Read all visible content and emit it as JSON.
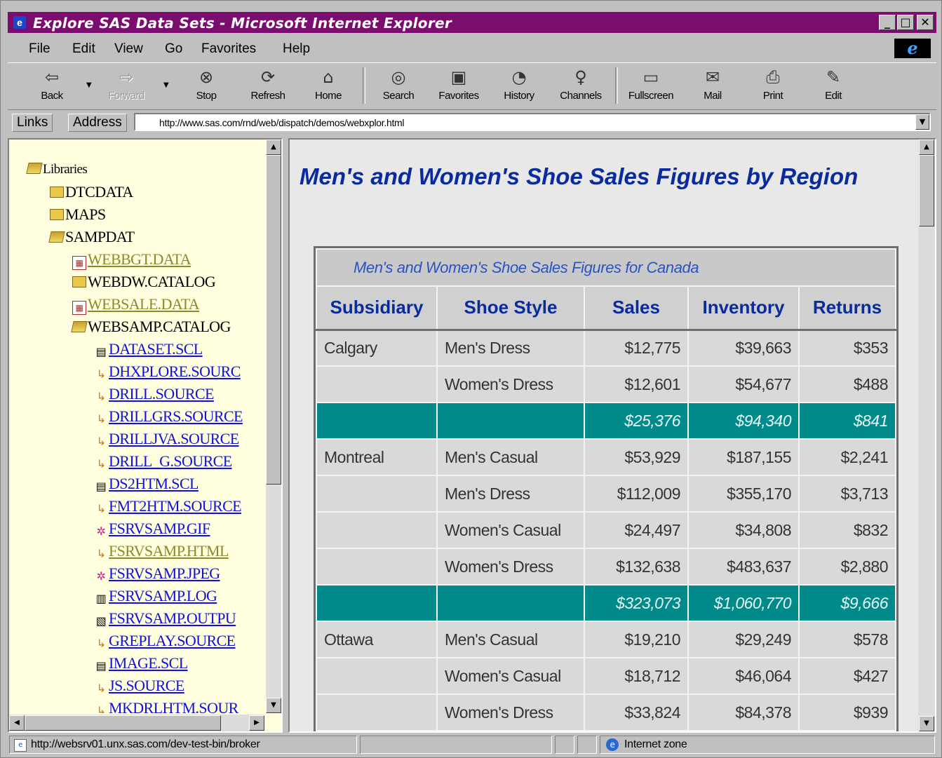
{
  "window": {
    "title": "Explore SAS Data Sets - Microsoft Internet Explorer"
  },
  "menu": [
    "File",
    "Edit",
    "View",
    "Go",
    "Favorites",
    "Help"
  ],
  "toolbar": {
    "back": "Back",
    "forward": "Forward",
    "stop": "Stop",
    "refresh": "Refresh",
    "home": "Home",
    "search": "Search",
    "favorites": "Favorites",
    "history": "History",
    "channels": "Channels",
    "fullscreen": "Fullscreen",
    "mail": "Mail",
    "print": "Print",
    "edit": "Edit"
  },
  "address": {
    "links_label": "Links",
    "address_label": "Address",
    "url": "http://www.sas.com/rnd/web/dispatch/demos/webxplor.html"
  },
  "tree": {
    "root": "Libraries",
    "libs": [
      "DTCDATA",
      "MAPS",
      "SAMPDAT"
    ],
    "sampdat_items": [
      "WEBBGT.DATA",
      "WEBDW.CATALOG",
      "WEBSALE.DATA",
      "WEBSAMP.CATALOG"
    ],
    "websamp_items": [
      "DATASET.SCL",
      "DHXPLORE.SOURC",
      "DRILL.SOURCE",
      "DRILLGRS.SOURCE",
      "DRILLJVA.SOURCE",
      "DRILL_G.SOURCE",
      "DS2HTM.SCL",
      "FMT2HTM.SOURCE",
      "FSRVSAMP.GIF",
      "FSRVSAMP.HTML",
      "FSRVSAMP.JPEG",
      "FSRVSAMP.LOG",
      "FSRVSAMP.OUTPU",
      "GREPLAY.SOURCE",
      "IMAGE.SCL",
      "JS.SOURCE",
      "MKDRLHTM.SOUR"
    ]
  },
  "page": {
    "title": "Men's and Women's Shoe Sales Figures by Region",
    "table_caption": "Men's and Women's Shoe Sales Figures for Canada",
    "columns": [
      "Subsidiary",
      "Shoe Style",
      "Sales",
      "Inventory",
      "Returns"
    ],
    "rows": [
      {
        "type": "data",
        "cells": [
          "Calgary",
          "Men's Dress",
          "$12,775",
          "$39,663",
          "$353"
        ]
      },
      {
        "type": "data",
        "cells": [
          "",
          "Women's Dress",
          "$12,601",
          "$54,677",
          "$488"
        ]
      },
      {
        "type": "total",
        "cells": [
          "",
          "",
          "$25,376",
          "$94,340",
          "$841"
        ]
      },
      {
        "type": "data",
        "cells": [
          "Montreal",
          "Men's Casual",
          "$53,929",
          "$187,155",
          "$2,241"
        ]
      },
      {
        "type": "data",
        "cells": [
          "",
          "Men's Dress",
          "$112,009",
          "$355,170",
          "$3,713"
        ]
      },
      {
        "type": "data",
        "cells": [
          "",
          "Women's Casual",
          "$24,497",
          "$34,808",
          "$832"
        ]
      },
      {
        "type": "data",
        "cells": [
          "",
          "Women's Dress",
          "$132,638",
          "$483,637",
          "$2,880"
        ]
      },
      {
        "type": "total",
        "cells": [
          "",
          "",
          "$323,073",
          "$1,060,770",
          "$9,666"
        ]
      },
      {
        "type": "data",
        "cells": [
          "Ottawa",
          "Men's Casual",
          "$19,210",
          "$29,249",
          "$578"
        ]
      },
      {
        "type": "data",
        "cells": [
          "",
          "Women's Casual",
          "$18,712",
          "$46,064",
          "$427"
        ]
      },
      {
        "type": "data",
        "cells": [
          "",
          "Women's Dress",
          "$33,824",
          "$84,378",
          "$939"
        ]
      }
    ]
  },
  "status": {
    "url": "http://websrv01.unx.sas.com/dev-test-bin/broker",
    "zone": "Internet zone"
  },
  "colors": {
    "title_bar": "#7b0d6e",
    "heading": "#0a2b9c",
    "total_row": "#008a8a",
    "tree_bg": "#ffffdf"
  }
}
